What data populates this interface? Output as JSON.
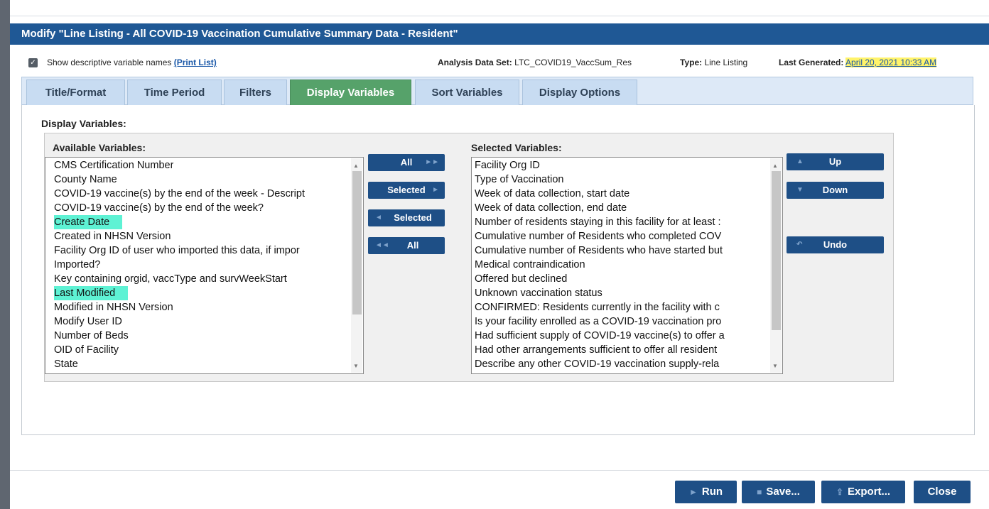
{
  "dialog": {
    "title": "Modify \"Line Listing - All COVID-19 Vaccination Cumulative Summary Data - Resident\""
  },
  "info": {
    "show_names_label": "Show descriptive variable names",
    "print_list_link": "(Print List)",
    "analysis_label": "Analysis Data Set:",
    "analysis_value": "LTC_COVID19_VaccSum_Res",
    "type_label": "Type:",
    "type_value": "Line Listing",
    "last_gen_label": "Last Generated:",
    "last_gen_value": "April 20, 2021 10:33 AM"
  },
  "tabs": [
    {
      "label": "Title/Format"
    },
    {
      "label": "Time Period"
    },
    {
      "label": "Filters"
    },
    {
      "label": "Display Variables"
    },
    {
      "label": "Sort Variables"
    },
    {
      "label": "Display Options"
    }
  ],
  "display_variables": {
    "section_label": "Display Variables:",
    "available_label": "Available Variables:",
    "selected_label": "Selected Variables:",
    "available": [
      "CMS Certification Number",
      "County Name",
      "COVID-19 vaccine(s) by the end of the week - Descript",
      "COVID-19 vaccine(s) by the end of the week?",
      "Create Date",
      "Created in NHSN Version",
      "Facility Org ID of user who imported this data, if impor",
      "Imported?",
      "Key containing orgid, vaccType and survWeekStart",
      "Last Modified",
      "Modified in NHSN Version",
      "Modify User ID",
      "Number of Beds",
      "OID of Facility",
      "State"
    ],
    "selected": [
      "Facility Org ID",
      "Type of Vaccination",
      "Week of data collection, start date",
      "Week of data collection, end date",
      "Number of residents staying in this facility for at least :",
      "Cumulative number of Residents who completed COV",
      "Cumulative number of Residents who have started but",
      "Medical contraindication",
      "Offered but declined",
      "Unknown vaccination status",
      "CONFIRMED: Residents currently in the facility with c",
      "Is your facility enrolled as a COVID-19 vaccination pro",
      "Had sufficient supply of COVID-19 vaccine(s) to offer a",
      "Had other arrangements sufficient to offer all resident",
      "Describe any other COVID-19 vaccination supply-rela"
    ],
    "highlight_color": "#5ef2d4",
    "move_buttons": {
      "all_right": "All",
      "selected_right": "Selected",
      "selected_left": "Selected",
      "all_left": "All"
    },
    "order_buttons": {
      "up": "Up",
      "down": "Down",
      "undo": "Undo"
    }
  },
  "footer": {
    "run": "Run",
    "save": "Save...",
    "export": "Export...",
    "close": "Close"
  },
  "colors": {
    "title_bar": "#1f5895",
    "active_tab": "#56a26a",
    "button": "#1e4f86"
  }
}
